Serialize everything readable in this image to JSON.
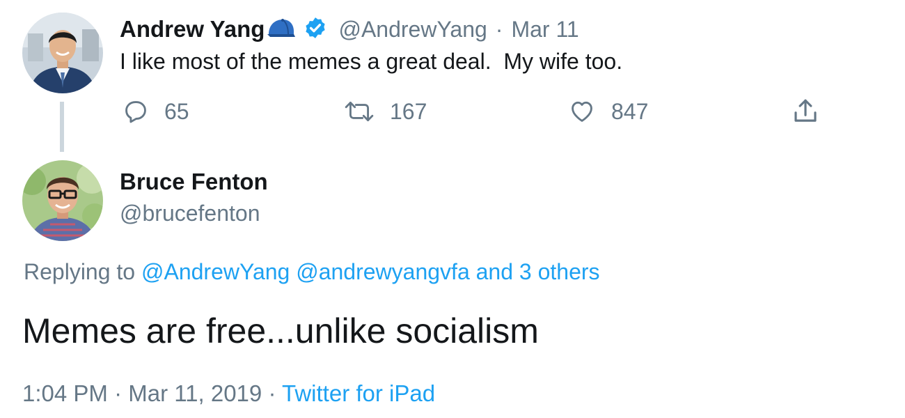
{
  "original_tweet": {
    "display_name": "Andrew Yang",
    "handle": "@AndrewYang",
    "separator": "·",
    "date": "Mar 11",
    "text": "I like most of the memes a great deal.  My wife too.",
    "actions": {
      "reply_count": "65",
      "retweet_count": "167",
      "like_count": "847"
    },
    "icons": {
      "name_emoji": "blue-cap-icon",
      "verified": "verified-badge-icon",
      "reply": "reply-icon",
      "retweet": "retweet-icon",
      "like": "heart-icon",
      "share": "share-icon"
    }
  },
  "reply_tweet": {
    "display_name": "Bruce Fenton",
    "handle": "@brucefenton",
    "replying_prefix": "Replying to",
    "replying_mentions": [
      "@AndrewYang",
      "@andrewyangvfa"
    ],
    "replying_others": "and 3 others",
    "text": "Memes are free...unlike socialism",
    "time": "1:04 PM",
    "date": "Mar 11, 2019",
    "separator": "·",
    "source": "Twitter for iPad"
  },
  "colors": {
    "text_primary": "#14171a",
    "text_secondary": "#657786",
    "link": "#1da1f2",
    "verified": "#1da1f2",
    "thread_line": "#ccd6dd"
  }
}
